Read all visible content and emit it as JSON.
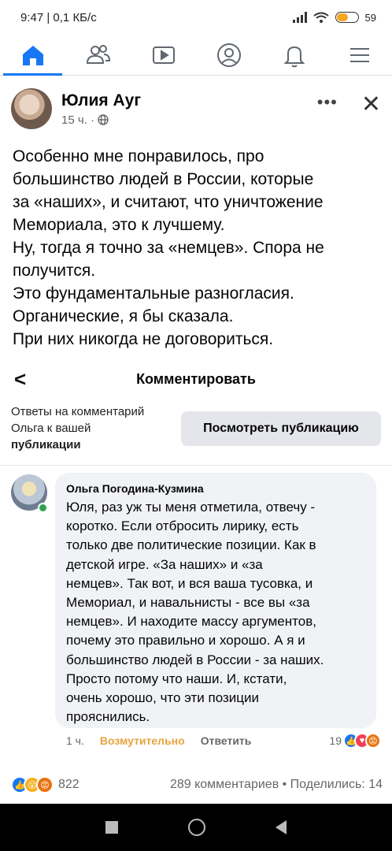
{
  "status_bar": {
    "time_speed": "9:47 | 0,1 КБ/с",
    "battery_percent": "59",
    "battery_level": 0.59,
    "battery_color": "#f5a623"
  },
  "nav_tabs": [
    {
      "name": "home-icon",
      "active": true
    },
    {
      "name": "friends-icon",
      "active": false
    },
    {
      "name": "watch-icon",
      "active": false
    },
    {
      "name": "profile-icon",
      "active": false
    },
    {
      "name": "notifications-icon",
      "active": false
    },
    {
      "name": "menu-icon",
      "active": false
    }
  ],
  "accent_color": "#1877f2",
  "post": {
    "author": "Юлия Ауг",
    "time": "15 ч. ·",
    "privacy_icon": "globe-icon",
    "more_label": "•••",
    "close_label": "✕",
    "lines": [
      "Особенно мне понравилось, про",
      "большинство людей в России, которые",
      "за «наших», и считают, что уничтожение",
      "Мемориала, это к лучшему.",
      "Ну, тогда я точно за «немцев». Спора не",
      "получится.",
      "Это фундаментальные разногласия.",
      "Органические, я бы сказала.",
      "При них никогда не договориться."
    ]
  },
  "comment_bar": {
    "back_label": "<",
    "title": "Комментировать"
  },
  "reply_context": {
    "line1": "Ответы на комментарий",
    "line2": "Ольга к вашей",
    "line3": "публикации",
    "view_post_button": "Посмотреть публикацию"
  },
  "comment": {
    "author": "Ольга Погодина-Кузмина",
    "lines": [
      "Юля, раз уж ты меня отметила, отвечу -",
      "коротко. Если отбросить лирику, есть",
      "только две политические позиции. Как в",
      "детской игре. «За наших» и «за",
      "немцев». Так вот, и вся ваша тусовка, и",
      "Мемориал, и навальнисты - все вы «за",
      "немцев». И находите массу аргументов,",
      "почему это правильно и хорошо. А я и",
      "большинство людей в России - за наших.",
      "Просто потому что наши. И, кстати,",
      "очень хорошо, что эти позиции",
      "прояснились."
    ],
    "time": "1 ч.",
    "reaction_label": "Возмутительно",
    "reply_label": "Ответить",
    "reactions_count": "19"
  },
  "footer": {
    "reactions_count": "822",
    "comments_shares": "289 комментариев • Поделились: 14"
  }
}
